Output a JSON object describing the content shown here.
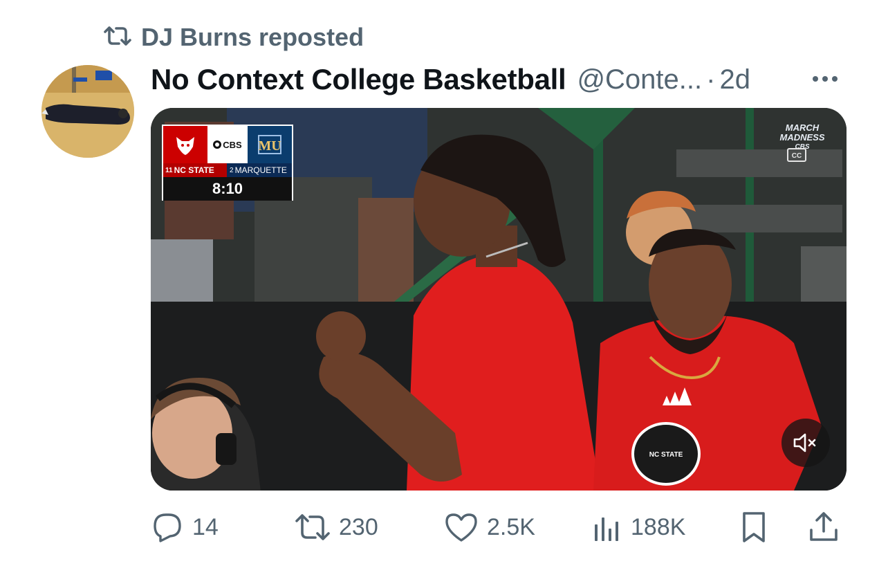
{
  "repost": {
    "icon": "repost-icon",
    "label": "DJ Burns reposted"
  },
  "author": {
    "avatar": "avatar",
    "display_name": "No Context College Basketball",
    "handle": "@Conte...",
    "separator": "·",
    "time": "2d",
    "more_icon": "more-icon"
  },
  "media": {
    "scorebug": {
      "network": "CBS",
      "team1_seed": "11",
      "team1_name": "NC STATE",
      "team2_seed": "2",
      "team2_name": "MARQUETTE",
      "clock": "8:10",
      "team1_color": "#cc0000",
      "team2_color": "#0b3d6e"
    },
    "logo_line1": "MARCH",
    "logo_line2": "MADNESS",
    "logo_line3": "CBS",
    "cc_icon": "closed-captions-icon",
    "mute_icon": "muted-speaker-icon",
    "shirt_logo_text": "NC STATE"
  },
  "actions": {
    "replies": {
      "icon": "reply-icon",
      "count": "14"
    },
    "reposts": {
      "icon": "repost-icon",
      "count": "230"
    },
    "likes": {
      "icon": "heart-icon",
      "count": "2.5K"
    },
    "views": {
      "icon": "views-icon",
      "count": "188K"
    },
    "bookmark": {
      "icon": "bookmark-icon"
    },
    "share": {
      "icon": "share-icon"
    }
  },
  "colors": {
    "secondary_text": "#536471",
    "primary_text": "#0f1419",
    "jersey_red": "#e01e1e"
  }
}
